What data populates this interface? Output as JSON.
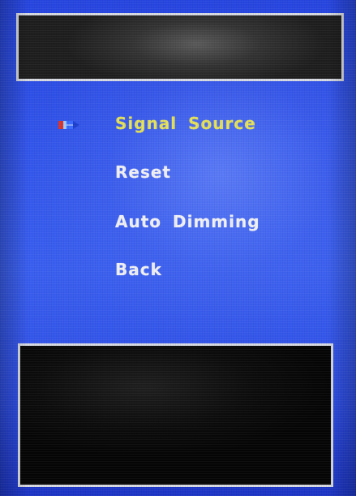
{
  "menu": {
    "items": [
      {
        "label": "Signal Source",
        "selected": true
      },
      {
        "label": "Reset",
        "selected": false
      },
      {
        "label": "Auto Dimming",
        "selected": false
      },
      {
        "label": "Back",
        "selected": false
      }
    ],
    "cursor_icon": "pencil-pointer-icon"
  },
  "colors": {
    "background": "#3356ec",
    "selected_text": "#e6e25a",
    "normal_text": "#f2f2f5",
    "panel_border": "#d9dbe3",
    "panel_fill": "#1e1e1e"
  }
}
